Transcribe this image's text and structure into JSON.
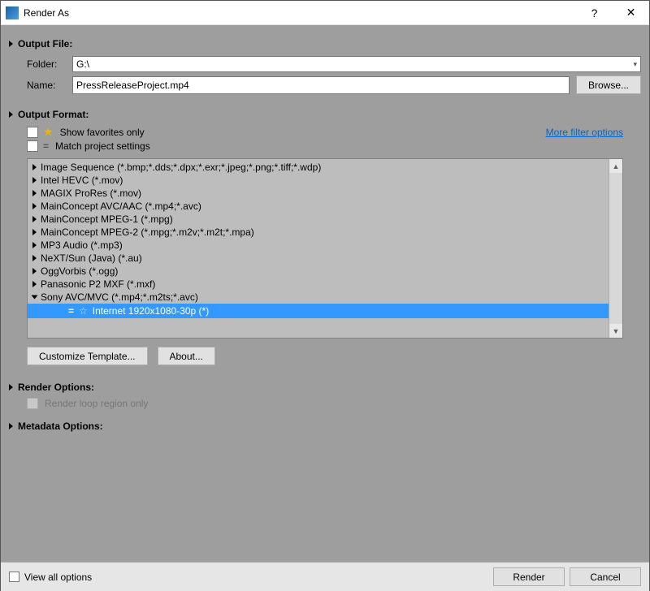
{
  "window": {
    "title": "Render As",
    "help_symbol": "?",
    "close_symbol": "✕"
  },
  "output_file": {
    "heading": "Output File:",
    "folder_label": "Folder:",
    "folder_value": "G:\\",
    "name_label": "Name:",
    "name_value": "PressReleaseProject.mp4",
    "browse_label": "Browse..."
  },
  "output_format": {
    "heading": "Output Format:",
    "show_favorites_label": "Show favorites only",
    "match_project_label": "Match project settings",
    "more_filter_label": "More filter options",
    "formats": [
      "Image Sequence (*.bmp;*.dds;*.dpx;*.exr;*.jpeg;*.png;*.tiff;*.wdp)",
      "Intel HEVC (*.mov)",
      "MAGIX ProRes (*.mov)",
      "MainConcept AVC/AAC (*.mp4;*.avc)",
      "MainConcept MPEG-1 (*.mpg)",
      "MainConcept MPEG-2 (*.mpg;*.m2v;*.m2t;*.mpa)",
      "MP3 Audio (*.mp3)",
      "NeXT/Sun (Java) (*.au)",
      "OggVorbis (*.ogg)",
      "Panasonic P2 MXF (*.mxf)",
      "Sony AVC/MVC (*.mp4;*.m2ts;*.avc)"
    ],
    "selected_template": "Internet 1920x1080-30p (*)",
    "customize_label": "Customize Template...",
    "about_label": "About..."
  },
  "render_options": {
    "heading": "Render Options:",
    "loop_region_label": "Render loop region only"
  },
  "metadata_options": {
    "heading": "Metadata Options:"
  },
  "bottom": {
    "view_all_label": "View all options",
    "render_label": "Render",
    "cancel_label": "Cancel"
  }
}
